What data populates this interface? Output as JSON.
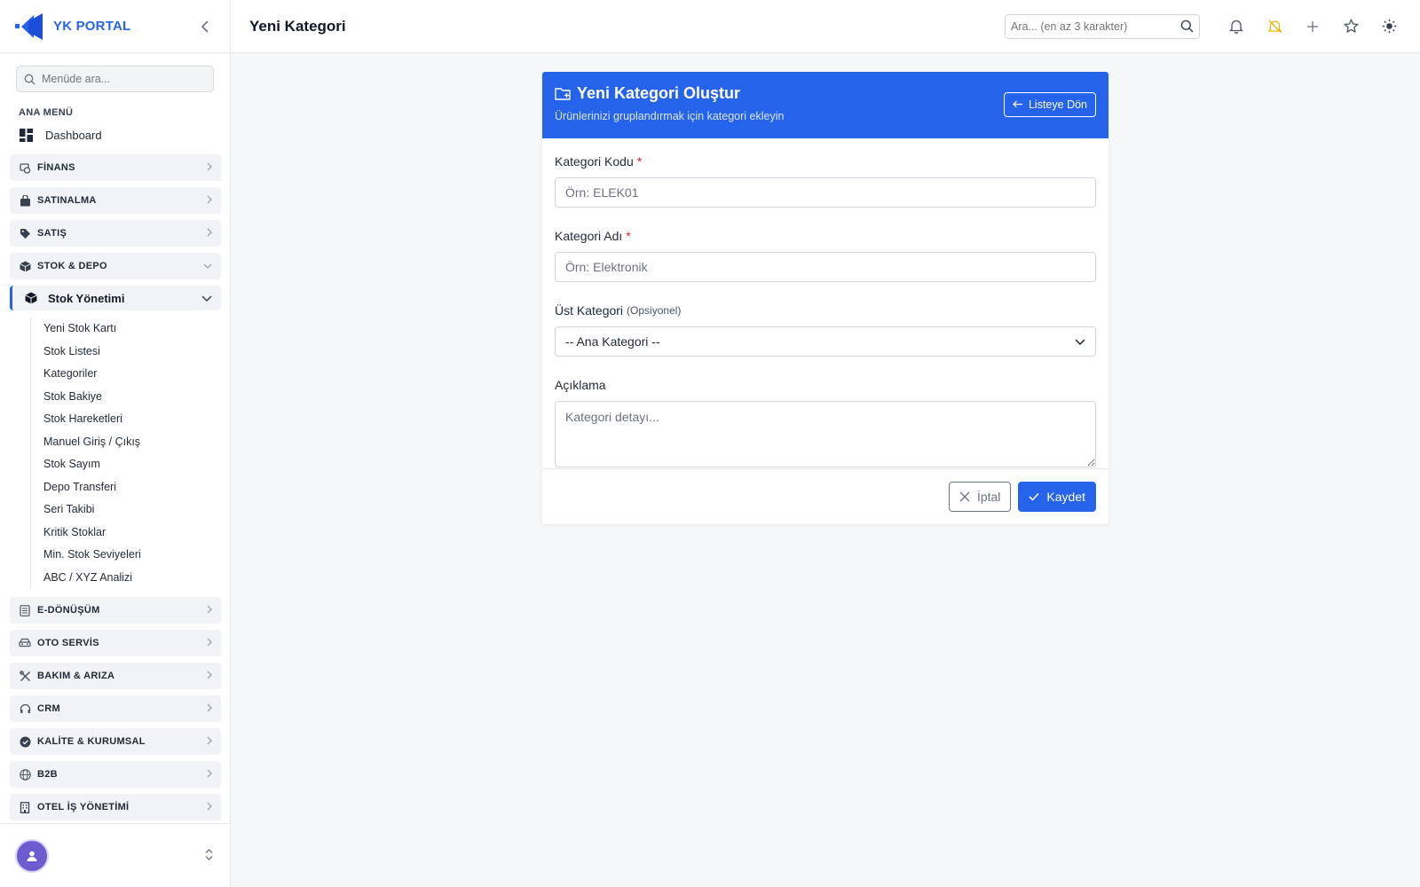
{
  "brand": {
    "name": "YK PORTAL"
  },
  "sidebar": {
    "search_placeholder": "Menüde ara...",
    "section_label": "ANA MENÜ",
    "dashboard_label": "Dashboard",
    "groups_before": [
      {
        "label": "FİNANS",
        "icon": "finance-icon"
      },
      {
        "label": "SATINALMA",
        "icon": "bag-icon"
      },
      {
        "label": "SATIŞ",
        "icon": "tag-icon"
      }
    ],
    "open_group": {
      "label": "STOK & DEPO",
      "icon": "box-icon"
    },
    "open_sub": {
      "label": "Stok Yönetimi",
      "icon": "box-icon"
    },
    "sub_items": [
      "Yeni Stok Kartı",
      "Stok Listesi",
      "Kategoriler",
      "Stok Bakiye",
      "Stok Hareketleri",
      "Manuel Giriş / Çıkış",
      "Stok Sayım",
      "Depo Transferi",
      "Seri Takibi",
      "Kritik Stoklar",
      "Min. Stok Seviyeleri",
      "ABC / XYZ Analizi"
    ],
    "groups_after": [
      {
        "label": "E-DÖNÜŞÜM",
        "icon": "document-icon"
      },
      {
        "label": "OTO SERVİS",
        "icon": "car-icon"
      },
      {
        "label": "BAKIM & ARIZA",
        "icon": "tools-icon"
      },
      {
        "label": "CRM",
        "icon": "headset-icon"
      },
      {
        "label": "KALİTE & KURUMSAL",
        "icon": "badge-check-icon"
      },
      {
        "label": "B2B",
        "icon": "globe-icon"
      },
      {
        "label": "OTEL İŞ YÖNETİMİ",
        "icon": "building-icon"
      }
    ]
  },
  "topbar": {
    "title": "Yeni Kategori",
    "search_placeholder": "Ara... (en az 3 karakter)"
  },
  "card": {
    "title": "Yeni Kategori Oluştur",
    "subtitle": "Ürünlerinizi gruplandırmak için kategori ekleyin",
    "back_label": "Listeye Dön",
    "fields": {
      "code_label": "Kategori Kodu",
      "code_placeholder": "Örn: ELEK01",
      "name_label": "Kategori Adı",
      "name_placeholder": "Örn: Elektronik",
      "parent_label": "Üst Kategori",
      "parent_optional": "(Opsiyonel)",
      "parent_value": "-- Ana Kategori --",
      "desc_label": "Açıklama",
      "desc_placeholder": "Kategori detayı...",
      "required_mark": "*"
    },
    "cancel_label": "İptal",
    "save_label": "Kaydet"
  },
  "colors": {
    "accent": "#2563eb",
    "required": "#dc2626",
    "bell_warning": "#eab308",
    "avatar": "#6d5bd0"
  }
}
